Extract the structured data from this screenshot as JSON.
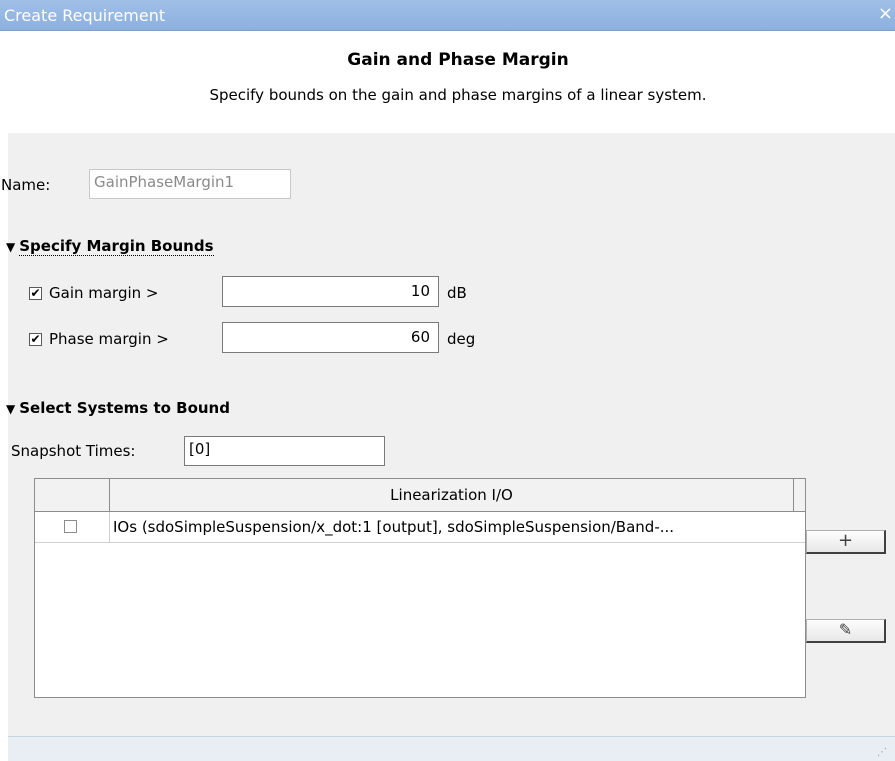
{
  "window": {
    "title": "Create Requirement",
    "close_glyph": "×"
  },
  "header": {
    "heading": "Gain and Phase Margin",
    "subheading": "Specify bounds on the gain and phase margins of a linear system."
  },
  "name_field": {
    "label": "Name:",
    "value": "GainPhaseMargin1"
  },
  "margin_section": {
    "title": "Specify Margin Bounds",
    "expanded": true,
    "gain": {
      "checked": true,
      "label": "Gain margin >",
      "value": "10",
      "unit": "dB"
    },
    "phase": {
      "checked": true,
      "label": "Phase margin >",
      "value": "60",
      "unit": "deg"
    }
  },
  "systems_section": {
    "title": "Select Systems to Bound",
    "expanded": true,
    "snapshot_label": "Snapshot Times:",
    "snapshot_value": "[0]",
    "table": {
      "column_header": "Linearization I/O",
      "rows": [
        {
          "checked": false,
          "io": "IOs (sdoSimpleSuspension/x_dot:1 [output], sdoSimpleSuspension/Band-..."
        }
      ]
    },
    "add_button_icon": "plus-icon",
    "add_button_glyph": "+",
    "edit_button_icon": "pencil-icon",
    "edit_button_glyph": "✎"
  },
  "ui": {
    "checkmark_glyph": "✔",
    "triangle_glyph": "▼",
    "resize_glyph": "⋰"
  },
  "colors": {
    "titlebar": "#8cb0de",
    "panel_background": "#f0f0f0",
    "header_background": "#ffffff"
  }
}
